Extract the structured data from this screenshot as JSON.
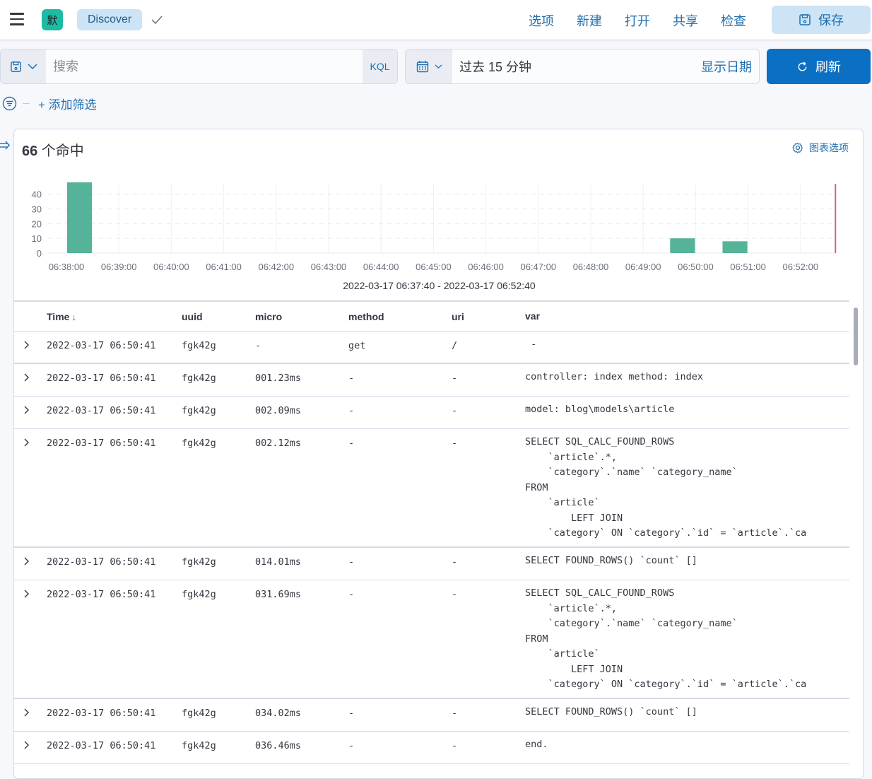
{
  "header": {
    "space_avatar": "默",
    "app_name": "Discover",
    "nav": [
      "选项",
      "新建",
      "打开",
      "共享",
      "检查"
    ],
    "save_label": "保存"
  },
  "query": {
    "placeholder": "搜索",
    "value": "",
    "language": "KQL"
  },
  "date": {
    "range_text": "过去 15 分钟",
    "show_dates": "显示日期",
    "refresh_label": "刷新"
  },
  "filters": {
    "add_label": "+ 添加筛选"
  },
  "results": {
    "hit_count": "66",
    "hit_suffix": " 个命中",
    "chart_options_label": "图表选项",
    "time_range": "2022-03-17 06:37:40 - 2022-03-17 06:52:40"
  },
  "colors": {
    "bar": "#54b399",
    "now_line": "#d36086",
    "accent": "#0b6fc4"
  },
  "chart_data": {
    "type": "bar",
    "title": "",
    "xlabel": "2022-03-17 06:37:40 - 2022-03-17 06:52:40",
    "ylabel": "",
    "interval": "30s",
    "x_ticks": [
      "06:38:00",
      "06:39:00",
      "06:40:00",
      "06:41:00",
      "06:42:00",
      "06:43:00",
      "06:44:00",
      "06:45:00",
      "06:46:00",
      "06:47:00",
      "06:48:00",
      "06:49:00",
      "06:50:00",
      "06:51:00",
      "06:52:00"
    ],
    "y_ticks": [
      0,
      10,
      20,
      30,
      40
    ],
    "ylim": [
      0,
      47
    ],
    "grid": true,
    "buckets": [
      {
        "start": "06:38:00",
        "value": 48
      },
      {
        "start": "06:49:30",
        "value": 10
      },
      {
        "start": "06:50:30",
        "value": 8
      }
    ],
    "now_marker": "06:52:40"
  },
  "table": {
    "columns": [
      "Time",
      "uuid",
      "micro",
      "method",
      "uri",
      "var"
    ],
    "sort": "desc",
    "rows": [
      {
        "time": "2022-03-17 06:50:41",
        "uuid": "fgk42g",
        "micro": " -",
        "method": "get",
        "uri": "/",
        "var": " -"
      },
      {
        "time": "2022-03-17 06:50:41",
        "uuid": "fgk42g",
        "micro": "001.23ms",
        "method": " -",
        "uri": " -",
        "var": "controller: index method: index"
      },
      {
        "time": "2022-03-17 06:50:41",
        "uuid": "fgk42g",
        "micro": "002.09ms",
        "method": " -",
        "uri": " -",
        "var": "model: blog\\models\\article"
      },
      {
        "time": "2022-03-17 06:50:41",
        "uuid": "fgk42g",
        "micro": "002.12ms",
        "method": " -",
        "uri": " -",
        "var": "SELECT SQL_CALC_FOUND_ROWS\n    `article`.*,\n    `category`.`name` `category_name`\nFROM\n    `article`\n        LEFT JOIN\n    `category` ON `category`.`id` = `article`.`ca"
      },
      {
        "time": "2022-03-17 06:50:41",
        "uuid": "fgk42g",
        "micro": "014.01ms",
        "method": " -",
        "uri": " -",
        "var": "SELECT FOUND_ROWS() `count` []"
      },
      {
        "time": "2022-03-17 06:50:41",
        "uuid": "fgk42g",
        "micro": "031.69ms",
        "method": " -",
        "uri": " -",
        "var": "SELECT SQL_CALC_FOUND_ROWS\n    `article`.*,\n    `category`.`name` `category_name`\nFROM\n    `article`\n        LEFT JOIN\n    `category` ON `category`.`id` = `article`.`ca"
      },
      {
        "time": "2022-03-17 06:50:41",
        "uuid": "fgk42g",
        "micro": "034.02ms",
        "method": " -",
        "uri": " -",
        "var": "SELECT FOUND_ROWS() `count` []"
      },
      {
        "time": "2022-03-17 06:50:41",
        "uuid": "fgk42g",
        "micro": "036.46ms",
        "method": " -",
        "uri": " -",
        "var": "end."
      }
    ]
  }
}
